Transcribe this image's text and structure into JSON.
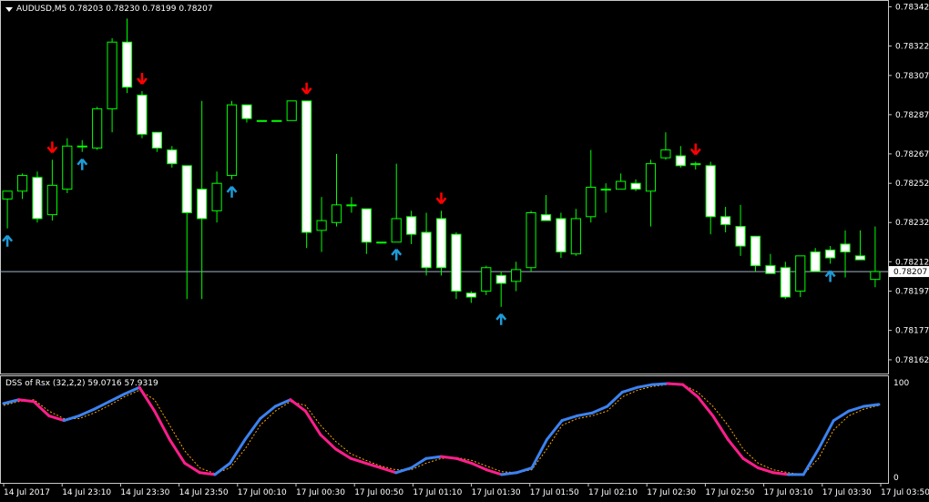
{
  "main_panel": {
    "symbol": "AUDUSD,M5",
    "ohlc_header": "0.78203 0.78230 0.78199 0.78207",
    "price_labels": [
      "0.78342",
      "0.78322",
      "0.78307",
      "0.78287",
      "0.78267",
      "0.78252",
      "0.78232",
      "0.78212",
      "0.78197",
      "0.78177",
      "0.78162"
    ],
    "current_price": "0.78207",
    "current_price_value": 0.78207
  },
  "indicator_panel": {
    "name": "DSS of Rsx (32,2,2)",
    "values": "59.0716 57.9319",
    "axis_labels": [
      "100",
      "0"
    ]
  },
  "time_labels": [
    "14 Jul 2017",
    "14 Jul 23:10",
    "14 Jul 23:30",
    "14 Jul 23:50",
    "17 Jul 00:10",
    "17 Jul 00:30",
    "17 Jul 00:50",
    "17 Jul 01:10",
    "17 Jul 01:30",
    "17 Jul 01:50",
    "17 Jul 02:10",
    "17 Jul 02:30",
    "17 Jul 02:50",
    "17 Jul 03:10",
    "17 Jul 03:30",
    "17 Jul 03:50"
  ],
  "colors": {
    "background": "#000000",
    "bull_candle": "#000000",
    "bear_candle": "#ffffff",
    "wick": "#00ff00",
    "up_arrow": "#1e9bd7",
    "down_arrow": "#ff0000",
    "dss_up": "#3c82f0",
    "dss_down": "#ff1e8c",
    "signal_line": "#ffa500",
    "current_price_line": "#a0b4c8",
    "grid_border": "#c8c8c8"
  },
  "chart_data": {
    "type": "candlestick",
    "candles": [
      {
        "o": 0.78244,
        "h": 0.78248,
        "l": 0.78229,
        "c": 0.78248
      },
      {
        "o": 0.78248,
        "h": 0.78257,
        "l": 0.78244,
        "c": 0.78256
      },
      {
        "o": 0.78255,
        "h": 0.78258,
        "l": 0.78232,
        "c": 0.78234
      },
      {
        "o": 0.78236,
        "h": 0.78264,
        "l": 0.78233,
        "c": 0.78251
      },
      {
        "o": 0.78249,
        "h": 0.78275,
        "l": 0.78247,
        "c": 0.78271
      },
      {
        "o": 0.78271,
        "h": 0.78274,
        "l": 0.78268,
        "c": 0.78271
      },
      {
        "o": 0.7827,
        "h": 0.78291,
        "l": 0.78269,
        "c": 0.7829
      },
      {
        "o": 0.7829,
        "h": 0.78326,
        "l": 0.78278,
        "c": 0.78324
      },
      {
        "o": 0.78324,
        "h": 0.78336,
        "l": 0.78298,
        "c": 0.78301
      },
      {
        "o": 0.78297,
        "h": 0.78299,
        "l": 0.78275,
        "c": 0.78277
      },
      {
        "o": 0.78278,
        "h": 0.78278,
        "l": 0.78268,
        "c": 0.7827
      },
      {
        "o": 0.78269,
        "h": 0.78271,
        "l": 0.7826,
        "c": 0.78262
      },
      {
        "o": 0.78261,
        "h": 0.78261,
        "l": 0.78193,
        "c": 0.78237
      },
      {
        "o": 0.78249,
        "h": 0.78294,
        "l": 0.78193,
        "c": 0.78234
      },
      {
        "o": 0.78238,
        "h": 0.78258,
        "l": 0.78232,
        "c": 0.78252
      },
      {
        "o": 0.78256,
        "h": 0.78294,
        "l": 0.78254,
        "c": 0.78292
      },
      {
        "o": 0.78292,
        "h": 0.78292,
        "l": 0.78283,
        "c": 0.78285
      },
      {
        "o": 0.78284,
        "h": 0.78284,
        "l": 0.78284,
        "c": 0.78284
      },
      {
        "o": 0.78284,
        "h": 0.78284,
        "l": 0.78284,
        "c": 0.78284
      },
      {
        "o": 0.78284,
        "h": 0.78294,
        "l": 0.78284,
        "c": 0.78294
      },
      {
        "o": 0.78294,
        "h": 0.78294,
        "l": 0.78219,
        "c": 0.78227
      },
      {
        "o": 0.78228,
        "h": 0.78245,
        "l": 0.78217,
        "c": 0.78233
      },
      {
        "o": 0.78232,
        "h": 0.78267,
        "l": 0.7823,
        "c": 0.78241
      },
      {
        "o": 0.78241,
        "h": 0.78245,
        "l": 0.78237,
        "c": 0.78241
      },
      {
        "o": 0.78239,
        "h": 0.78239,
        "l": 0.78216,
        "c": 0.78222
      },
      {
        "o": 0.78222,
        "h": 0.78222,
        "l": 0.78222,
        "c": 0.78222
      },
      {
        "o": 0.78222,
        "h": 0.78262,
        "l": 0.78222,
        "c": 0.78234
      },
      {
        "o": 0.78235,
        "h": 0.78238,
        "l": 0.78221,
        "c": 0.78226
      },
      {
        "o": 0.78227,
        "h": 0.78237,
        "l": 0.78205,
        "c": 0.78209
      },
      {
        "o": 0.78234,
        "h": 0.78238,
        "l": 0.78205,
        "c": 0.78209
      },
      {
        "o": 0.78226,
        "h": 0.78227,
        "l": 0.78193,
        "c": 0.78197
      },
      {
        "o": 0.78196,
        "h": 0.78197,
        "l": 0.78191,
        "c": 0.78194
      },
      {
        "o": 0.78197,
        "h": 0.7821,
        "l": 0.78195,
        "c": 0.78209
      },
      {
        "o": 0.78205,
        "h": 0.78207,
        "l": 0.78189,
        "c": 0.78201
      },
      {
        "o": 0.78202,
        "h": 0.78212,
        "l": 0.78197,
        "c": 0.78208
      },
      {
        "o": 0.78209,
        "h": 0.78238,
        "l": 0.78207,
        "c": 0.78237
      },
      {
        "o": 0.78236,
        "h": 0.78246,
        "l": 0.78234,
        "c": 0.78233
      },
      {
        "o": 0.78234,
        "h": 0.78237,
        "l": 0.78214,
        "c": 0.78217
      },
      {
        "o": 0.78216,
        "h": 0.78239,
        "l": 0.78215,
        "c": 0.78234
      },
      {
        "o": 0.78235,
        "h": 0.78269,
        "l": 0.78232,
        "c": 0.7825
      },
      {
        "o": 0.78249,
        "h": 0.78252,
        "l": 0.78237,
        "c": 0.78249
      },
      {
        "o": 0.78249,
        "h": 0.78257,
        "l": 0.78249,
        "c": 0.78253
      },
      {
        "o": 0.78252,
        "h": 0.78254,
        "l": 0.78248,
        "c": 0.78249
      },
      {
        "o": 0.78248,
        "h": 0.78264,
        "l": 0.7823,
        "c": 0.78262
      },
      {
        "o": 0.78265,
        "h": 0.78278,
        "l": 0.78264,
        "c": 0.78269
      },
      {
        "o": 0.78266,
        "h": 0.78271,
        "l": 0.7826,
        "c": 0.78261
      },
      {
        "o": 0.78262,
        "h": 0.78263,
        "l": 0.78259,
        "c": 0.78262
      },
      {
        "o": 0.78261,
        "h": 0.78263,
        "l": 0.78226,
        "c": 0.78235
      },
      {
        "o": 0.78235,
        "h": 0.7824,
        "l": 0.78227,
        "c": 0.78231
      },
      {
        "o": 0.7823,
        "h": 0.78241,
        "l": 0.78215,
        "c": 0.7822
      },
      {
        "o": 0.78225,
        "h": 0.78225,
        "l": 0.78207,
        "c": 0.7821
      },
      {
        "o": 0.7821,
        "h": 0.78216,
        "l": 0.78206,
        "c": 0.78206
      },
      {
        "o": 0.78209,
        "h": 0.78212,
        "l": 0.78193,
        "c": 0.78194
      },
      {
        "o": 0.78197,
        "h": 0.78215,
        "l": 0.78194,
        "c": 0.78215
      },
      {
        "o": 0.78217,
        "h": 0.78219,
        "l": 0.78207,
        "c": 0.78207
      },
      {
        "o": 0.78218,
        "h": 0.7822,
        "l": 0.78211,
        "c": 0.78214
      },
      {
        "o": 0.78221,
        "h": 0.78228,
        "l": 0.78204,
        "c": 0.78217
      },
      {
        "o": 0.78215,
        "h": 0.78228,
        "l": 0.78215,
        "c": 0.78213
      },
      {
        "o": 0.78203,
        "h": 0.7823,
        "l": 0.78199,
        "c": 0.78207
      }
    ],
    "signals": [
      {
        "i": 0,
        "dir": "up"
      },
      {
        "i": 3,
        "dir": "down"
      },
      {
        "i": 5,
        "dir": "up"
      },
      {
        "i": 9,
        "dir": "down"
      },
      {
        "i": 15,
        "dir": "up"
      },
      {
        "i": 20,
        "dir": "down"
      },
      {
        "i": 26,
        "dir": "up"
      },
      {
        "i": 29,
        "dir": "down"
      },
      {
        "i": 33,
        "dir": "up"
      },
      {
        "i": 46,
        "dir": "down"
      },
      {
        "i": 55,
        "dir": "up"
      }
    ],
    "ylim": [
      0.78155,
      0.78345
    ],
    "dss": {
      "ylim": [
        0,
        100
      ],
      "main": [
        78,
        82,
        80,
        65,
        60,
        65,
        72,
        80,
        88,
        95,
        70,
        40,
        15,
        5,
        3,
        15,
        40,
        62,
        75,
        82,
        70,
        45,
        30,
        20,
        15,
        10,
        5,
        10,
        20,
        22,
        20,
        15,
        8,
        3,
        5,
        10,
        40,
        60,
        65,
        68,
        75,
        90,
        95,
        98,
        99,
        98,
        85,
        65,
        40,
        20,
        10,
        5,
        3,
        3,
        30,
        60,
        70,
        75,
        77
      ],
      "signal": [
        76,
        80,
        82,
        70,
        62,
        62,
        68,
        76,
        85,
        92,
        82,
        55,
        28,
        10,
        4,
        10,
        30,
        55,
        70,
        80,
        76,
        55,
        38,
        25,
        18,
        12,
        8,
        8,
        15,
        20,
        21,
        18,
        12,
        6,
        5,
        8,
        30,
        55,
        62,
        65,
        70,
        85,
        92,
        96,
        98,
        98,
        90,
        75,
        55,
        30,
        15,
        8,
        5,
        3,
        20,
        50,
        65,
        72,
        76
      ]
    }
  }
}
